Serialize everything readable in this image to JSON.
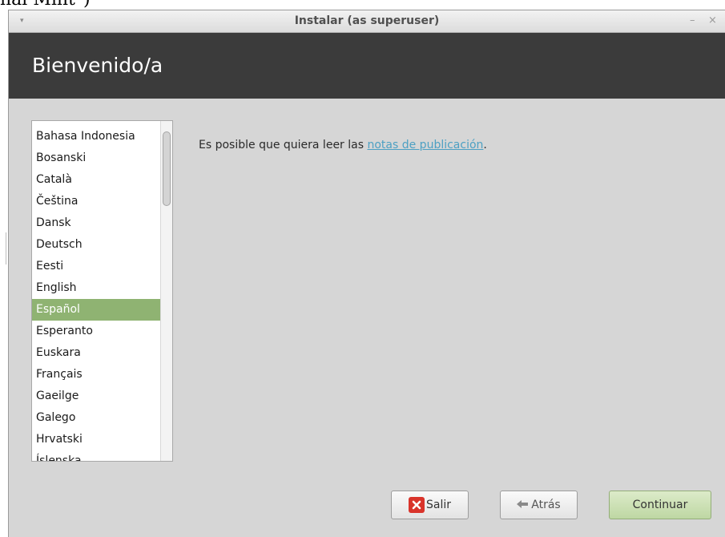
{
  "background_cut_text": "nal Mint\")",
  "window": {
    "title": "Instalar (as superuser)",
    "minimize_glyph": "–",
    "close_glyph": "×",
    "menu_glyph": "▾"
  },
  "header": {
    "title": "Bienvenido/a"
  },
  "languages": {
    "items": [
      "Bahasa Indonesia",
      "Bosanski",
      "Català",
      "Čeština",
      "Dansk",
      "Deutsch",
      "Eesti",
      "English",
      "Español",
      "Esperanto",
      "Euskara",
      "Français",
      "Gaeilge",
      "Galego",
      "Hrvatski",
      "Íslenska"
    ],
    "selected": "Español"
  },
  "release_notes": {
    "prefix": "Es posible que quiera leer las ",
    "link": "notas de publicación",
    "suffix": "."
  },
  "buttons": {
    "quit": "Salir",
    "back": "Atrás",
    "continue": "Continuar"
  },
  "icons": {
    "quit": "close-x-icon",
    "back": "arrow-left-icon"
  },
  "colors": {
    "header_bg": "#3b3b3b",
    "selection": "#8fb372",
    "link": "#4da0c3",
    "quit_icon": "#d9342b",
    "continue_bg": "#c9dfb1"
  }
}
